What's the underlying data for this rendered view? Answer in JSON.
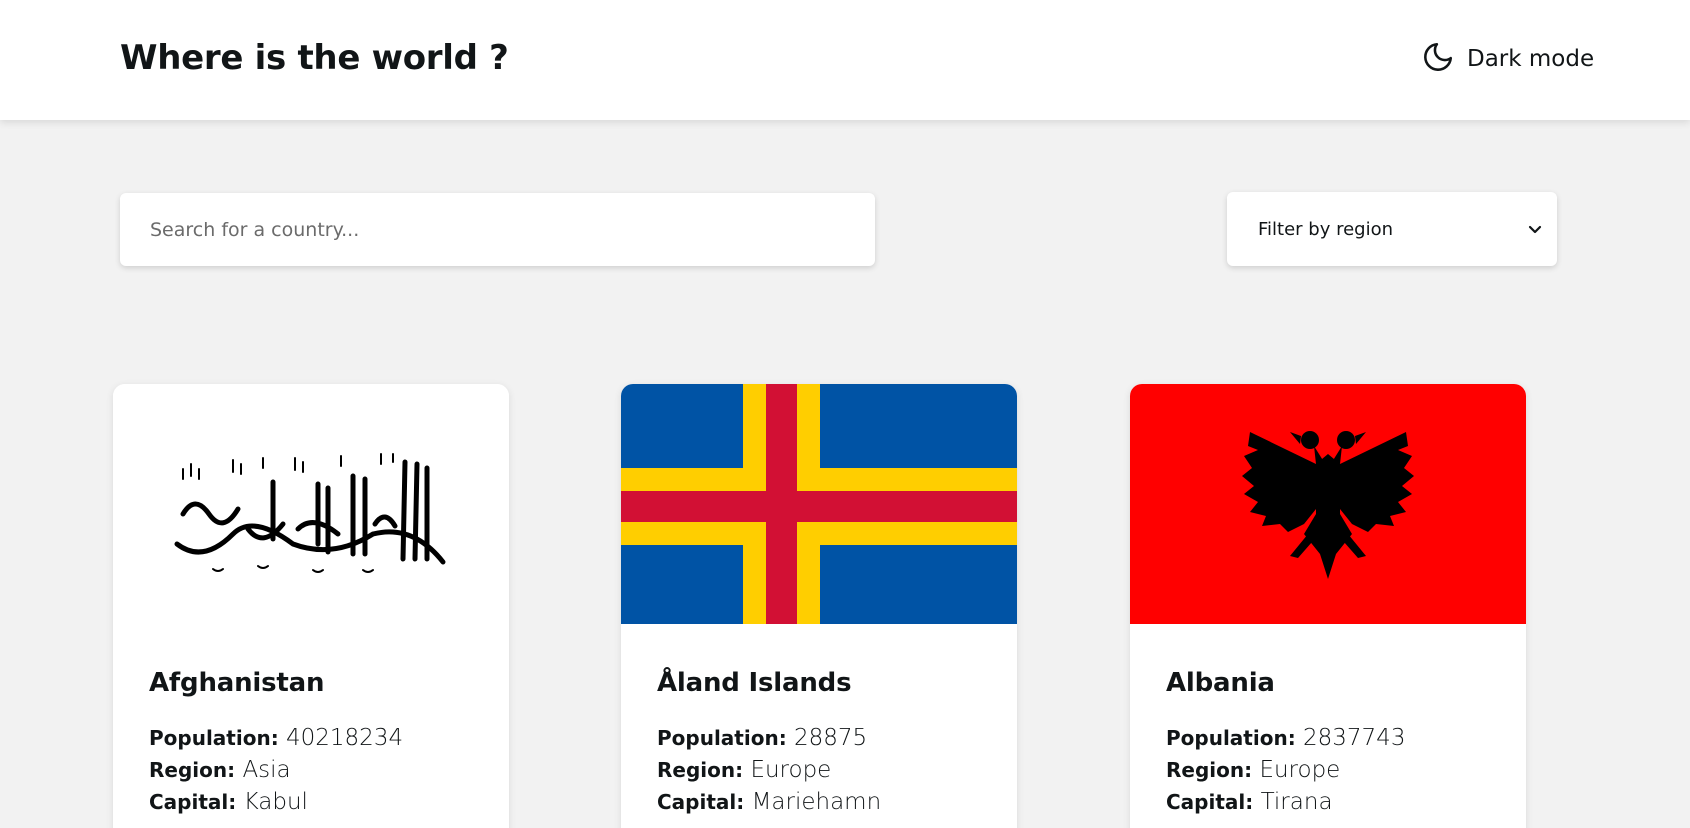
{
  "header": {
    "title": "Where is the world ?",
    "dark_mode_label": "Dark mode",
    "dark_mode_icon": "moon-icon"
  },
  "search": {
    "placeholder": "Search for a country..."
  },
  "filter": {
    "selected": "Filter by region",
    "icon": "chevron-down-icon"
  },
  "labels": {
    "population": "Population:",
    "region": "Region:",
    "capital": "Capital:"
  },
  "countries": [
    {
      "name": "Afghanistan",
      "population": "40218234",
      "region": "Asia",
      "capital": "Kabul",
      "flag": "afghanistan-flag"
    },
    {
      "name": "Åland Islands",
      "population": "28875",
      "region": "Europe",
      "capital": "Mariehamn",
      "flag": "aland-islands-flag"
    },
    {
      "name": "Albania",
      "population": "2837743",
      "region": "Europe",
      "capital": "Tirana",
      "flag": "albania-flag"
    }
  ],
  "colors": {
    "background": "#f2f2f2",
    "surface": "#ffffff",
    "text": "#111517",
    "aland_blue": "#0053a5",
    "aland_yellow": "#ffce00",
    "aland_red": "#d21034",
    "albania_red": "#ff0000"
  }
}
